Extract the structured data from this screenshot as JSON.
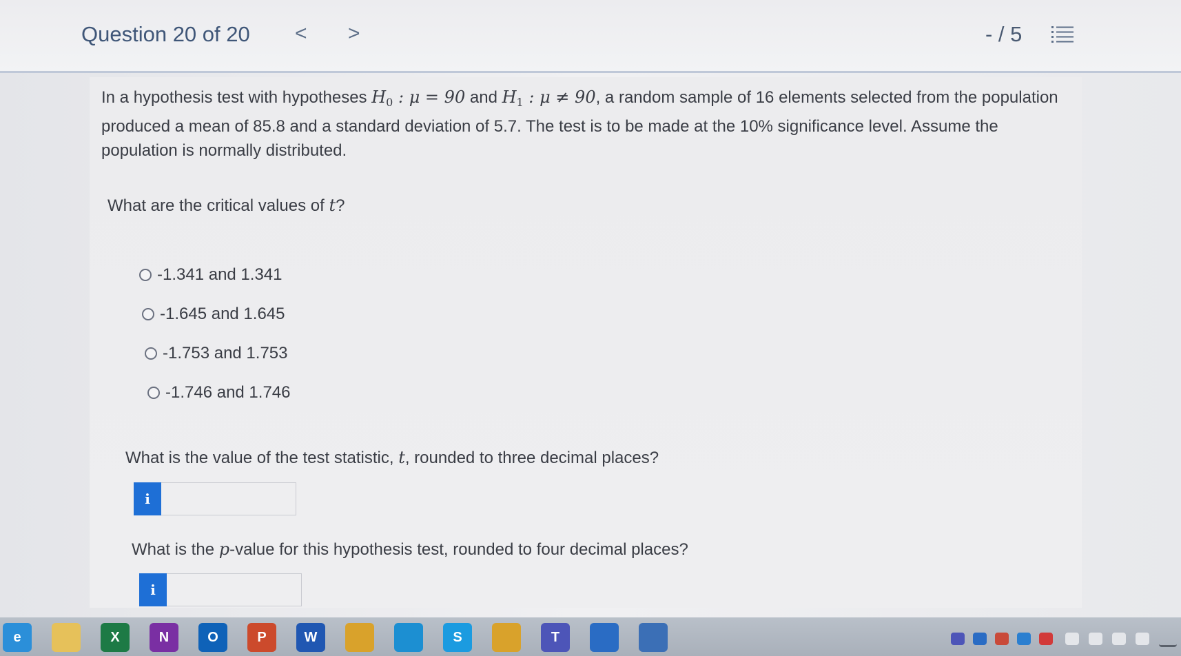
{
  "header": {
    "question_counter": "Question 20 of 20",
    "prev_glyph": "<",
    "next_glyph": ">",
    "score": "- / 5",
    "list_icon": "list-icon"
  },
  "problem": {
    "text_1": "In a hypothesis test with hypotheses ",
    "h0_letter": "H",
    "h0_sub": "0",
    "h0_rest": " : μ = 90",
    "and_text": " and ",
    "h1_letter": "H",
    "h1_sub": "1",
    "h1_rest": " : μ ≠ 90",
    "text_2": ", a random sample of 16 elements selected from the population produced a mean of 85.8 and a standard deviation of 5.7. The test is to be made at the 10% significance level. Assume the population is normally distributed."
  },
  "question_1": {
    "prompt_before": "What are the critical values of ",
    "prompt_var": "t",
    "prompt_after": "?",
    "options": [
      "-1.341 and 1.341",
      "-1.645 and 1.645",
      "-1.753 and 1.753",
      "-1.746 and 1.746"
    ]
  },
  "question_2": {
    "prompt_before": "What is the value of the test statistic, ",
    "prompt_var": "t",
    "prompt_after": ", rounded to three decimal places?",
    "info_glyph": "i",
    "value": ""
  },
  "question_3": {
    "prompt_before": "What is the ",
    "prompt_var": "p",
    "prompt_after": "-value for this hypothesis test, rounded to four decimal places?",
    "info_glyph": "i",
    "value": ""
  },
  "taskbar": {
    "apps": [
      {
        "name": "edge-legacy-icon",
        "glyph": "e",
        "color": "#2b8fd9"
      },
      {
        "name": "file-explorer-icon",
        "glyph": "",
        "color": "#e6c15a"
      },
      {
        "name": "excel-icon",
        "glyph": "X",
        "color": "#1d7a45"
      },
      {
        "name": "onenote-icon",
        "glyph": "N",
        "color": "#7a2fa3"
      },
      {
        "name": "outlook-icon",
        "glyph": "O",
        "color": "#0f62b8"
      },
      {
        "name": "powerpoint-icon",
        "glyph": "P",
        "color": "#cc4a2c"
      },
      {
        "name": "word-icon",
        "glyph": "W",
        "color": "#2057b2"
      },
      {
        "name": "chrome-icon",
        "glyph": "",
        "color": "#d9a22b"
      },
      {
        "name": "edge-icon",
        "glyph": "",
        "color": "#1c8fd2"
      },
      {
        "name": "skype-icon",
        "glyph": "S",
        "color": "#1b9be0"
      },
      {
        "name": "chrome-profile-icon",
        "glyph": "",
        "color": "#d9a22b"
      },
      {
        "name": "teams-icon",
        "glyph": "T",
        "color": "#4d55b8"
      },
      {
        "name": "security-shield-icon",
        "glyph": "",
        "color": "#2a6cc4"
      },
      {
        "name": "globe-app-icon",
        "glyph": "",
        "color": "#3b6fb6"
      }
    ]
  }
}
